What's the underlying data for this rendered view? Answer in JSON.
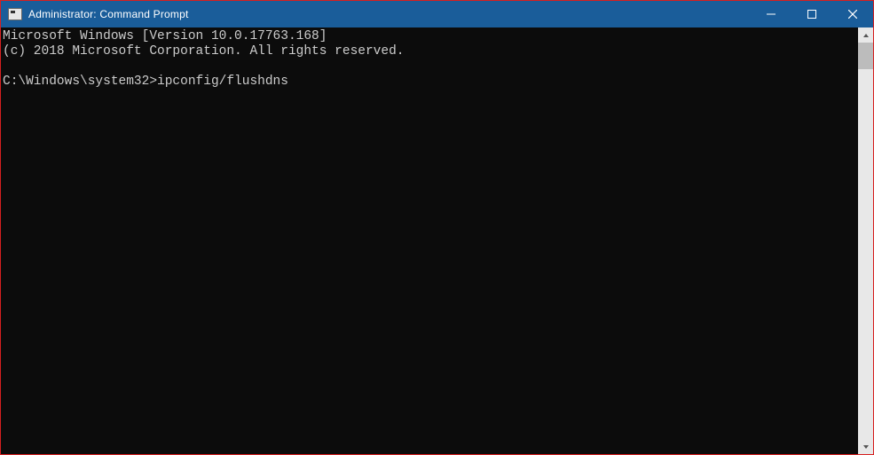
{
  "window": {
    "title": "Administrator: Command Prompt"
  },
  "terminal": {
    "line1": "Microsoft Windows [Version 10.0.17763.168]",
    "line2": "(c) 2018 Microsoft Corporation. All rights reserved.",
    "blank": "",
    "prompt": "C:\\Windows\\system32>",
    "command": "ipconfig/flushdns"
  }
}
